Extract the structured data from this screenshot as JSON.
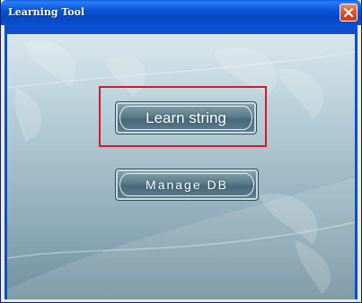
{
  "window": {
    "title": "Learning Tool",
    "close_icon": "close-icon"
  },
  "main": {
    "learn_string_label": "Learn string",
    "manage_db_label": "Manage DB"
  },
  "colors": {
    "titlebar": "#0a55d9",
    "highlight": "#d8172a",
    "button": "#5b7d8a"
  }
}
